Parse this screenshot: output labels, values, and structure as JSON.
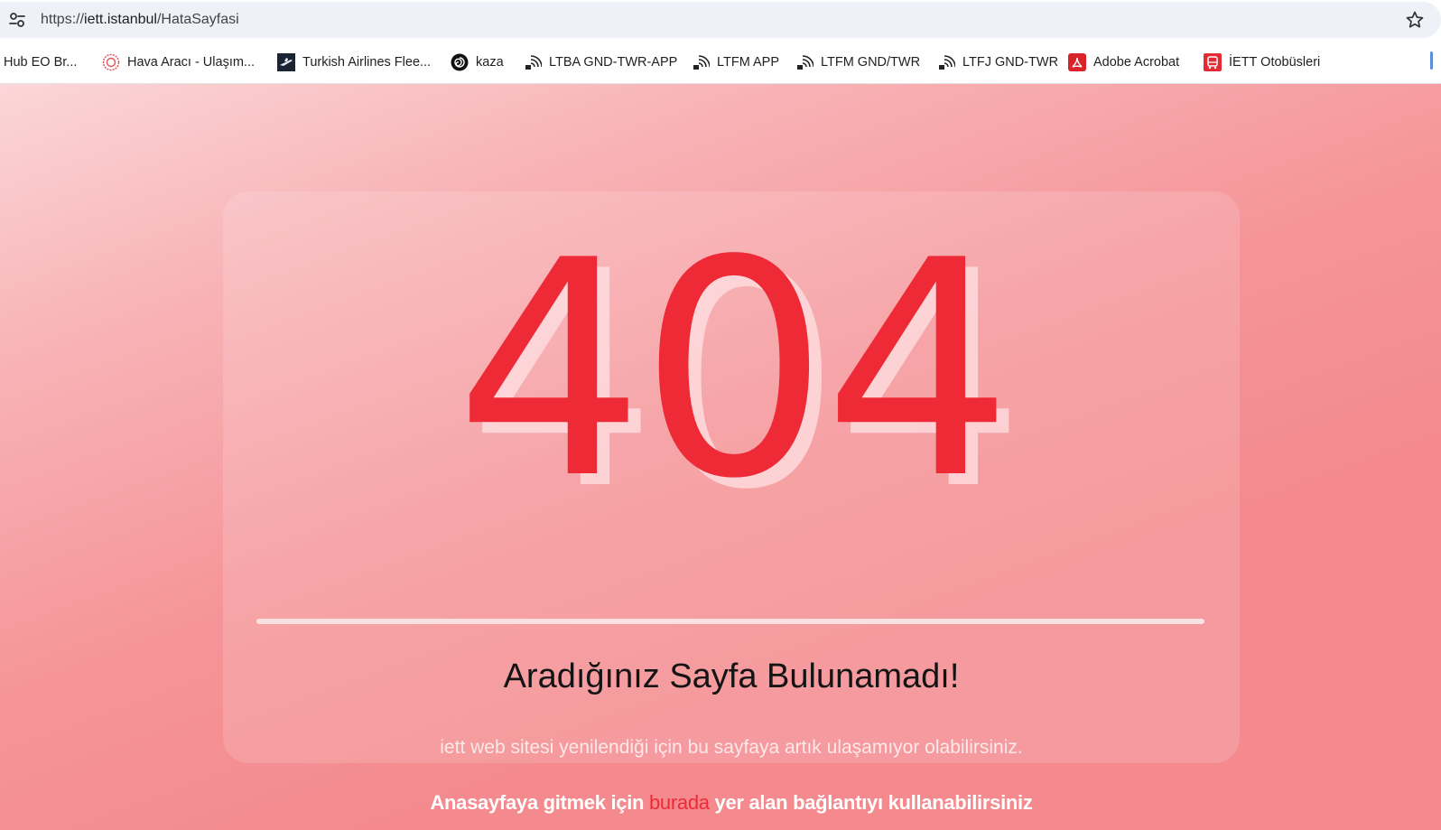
{
  "browser": {
    "url_scheme": "https://",
    "url_host": "iett.istanbul",
    "url_path": "/HataSayfasi"
  },
  "bookmarks": [
    {
      "label": "Hub EO Br...",
      "icon": "none"
    },
    {
      "label": "Hava Aracı - Ulaşım...",
      "icon": "ministry-seal-icon"
    },
    {
      "label": "Turkish Airlines Flee...",
      "icon": "plane-icon"
    },
    {
      "label": "kaza",
      "icon": "spiral-icon"
    },
    {
      "label": "LTBA GND-TWR-APP",
      "icon": "radio-signal-icon"
    },
    {
      "label": "LTFM APP",
      "icon": "radio-signal-icon"
    },
    {
      "label": "LTFM GND/TWR",
      "icon": "radio-signal-icon"
    },
    {
      "label": "LTFJ GND-TWR",
      "icon": "radio-signal-icon"
    },
    {
      "label": "Adobe Acrobat",
      "icon": "acrobat-icon"
    },
    {
      "label": "İETT Otobüsleri",
      "icon": "bus-icon"
    }
  ],
  "page": {
    "error_code": "404",
    "title": "Aradığınız Sayfa Bulunamadı!",
    "description": "iett web sitesi yenilendiği için bu sayfaya artık ulaşamıyor olabilirsiniz.",
    "cta_before": "Anasayfaya gitmek için ",
    "cta_link": "burada",
    "cta_after": " yer alan bağlantıyı kullanabilirsiniz"
  },
  "colors": {
    "accent_red": "#ee2a36",
    "background_pink": "#f48a8e"
  }
}
